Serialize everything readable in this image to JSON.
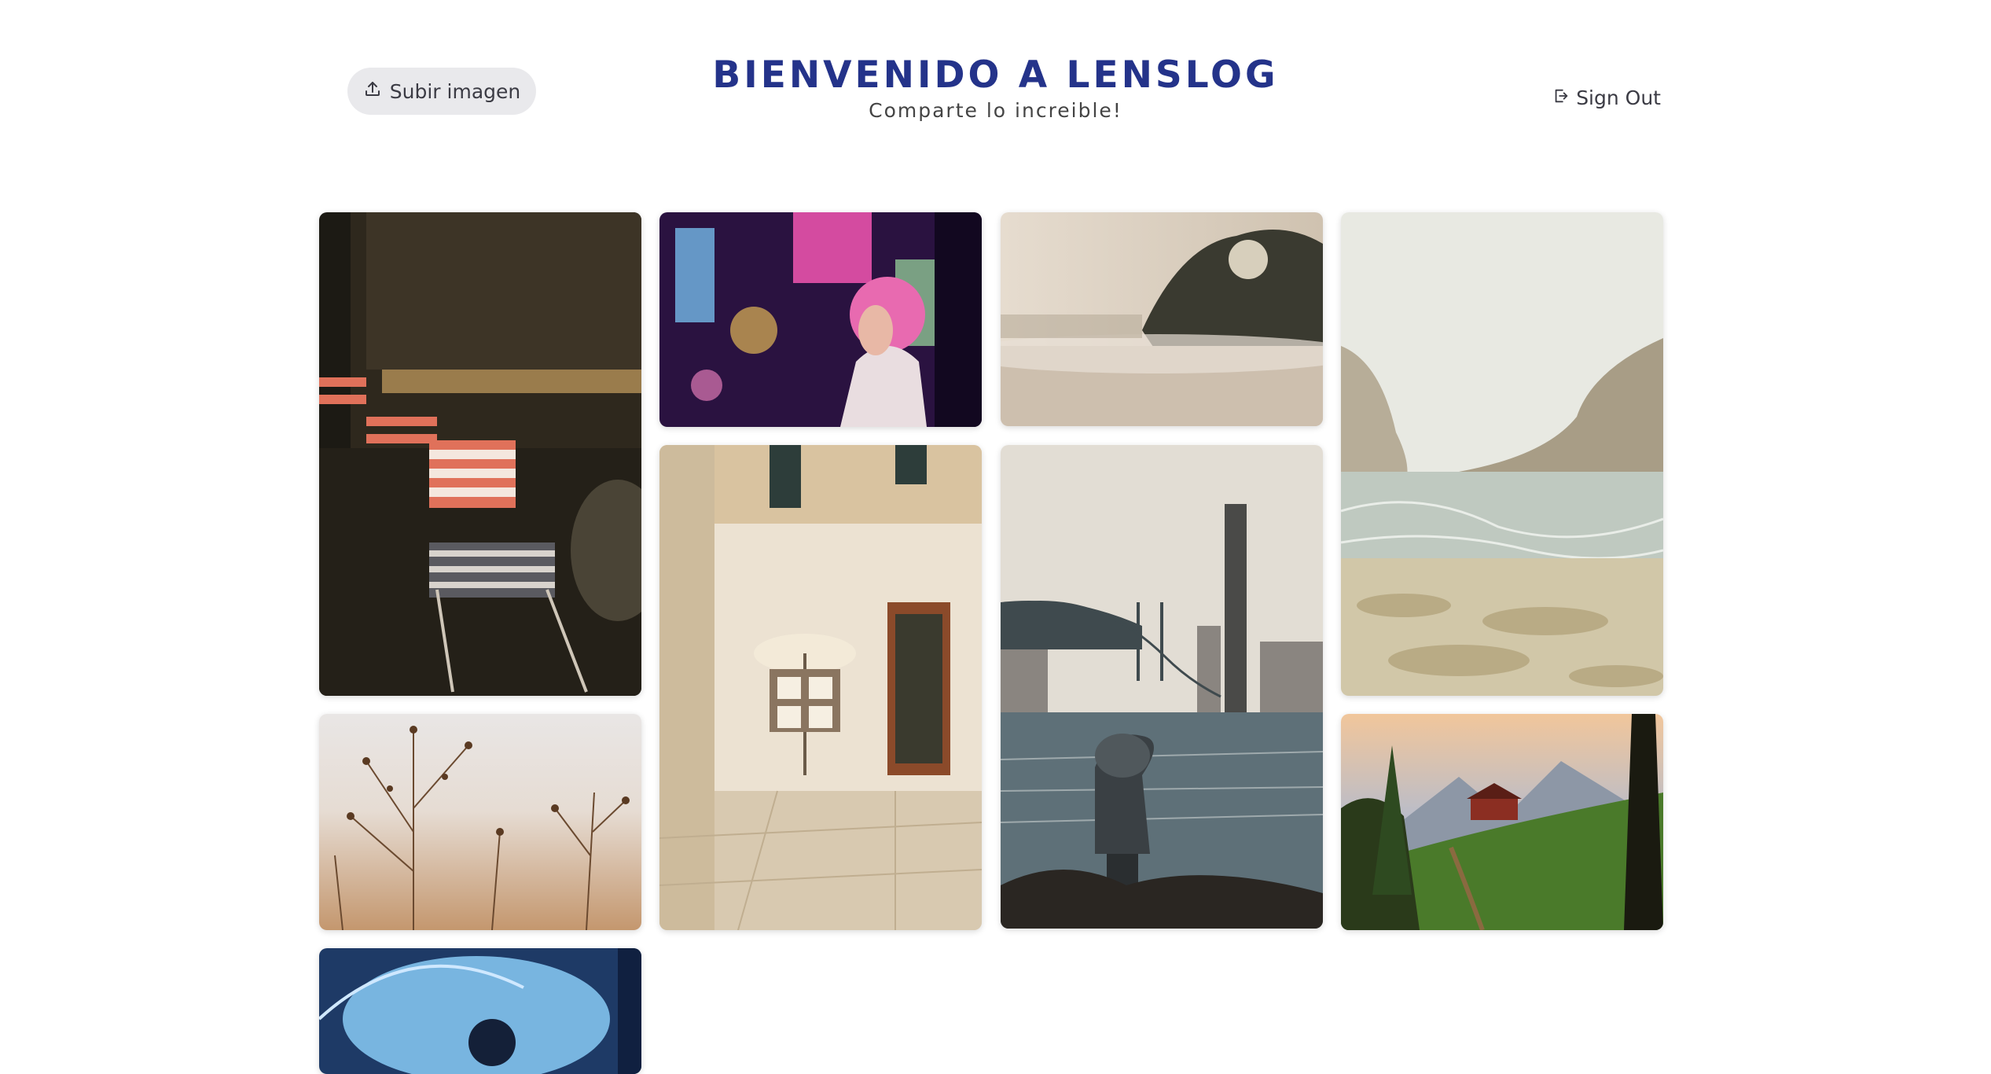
{
  "header": {
    "upload_label": "Subir imagen",
    "title": "BIENVENIDO A LENSLOG",
    "subtitle": "Comparte lo increible!",
    "signout_label": "Sign Out"
  },
  "gallery": {
    "photos": [
      {
        "subject": "cafe-terrace-chairs",
        "colors": [
          "#1c1a14",
          "#e0715a"
        ]
      },
      {
        "subject": "neon-city-night",
        "colors": [
          "#2a1240",
          "#e86ab0"
        ]
      },
      {
        "subject": "misty-lake-sunrise",
        "colors": [
          "#d9cfc3",
          "#3a3a30"
        ]
      },
      {
        "subject": "rocky-coast-waves",
        "colors": [
          "#e8e9e2",
          "#9a9a8a"
        ]
      },
      {
        "subject": "venice-street-artist",
        "colors": [
          "#e2d0b4",
          "#8b4a2a"
        ]
      },
      {
        "subject": "bridge-river-binoculars",
        "colors": [
          "#dcd8cf",
          "#4a5a60"
        ]
      },
      {
        "subject": "dry-plants-field",
        "colors": [
          "#e9e6e5",
          "#a9714a"
        ]
      },
      {
        "subject": "mountain-cabin-meadow",
        "colors": [
          "#4a7a2a",
          "#1a1a10"
        ]
      },
      {
        "subject": "umbrella-blue-light",
        "colors": [
          "#1e3a66",
          "#8fd4ff"
        ]
      }
    ]
  }
}
